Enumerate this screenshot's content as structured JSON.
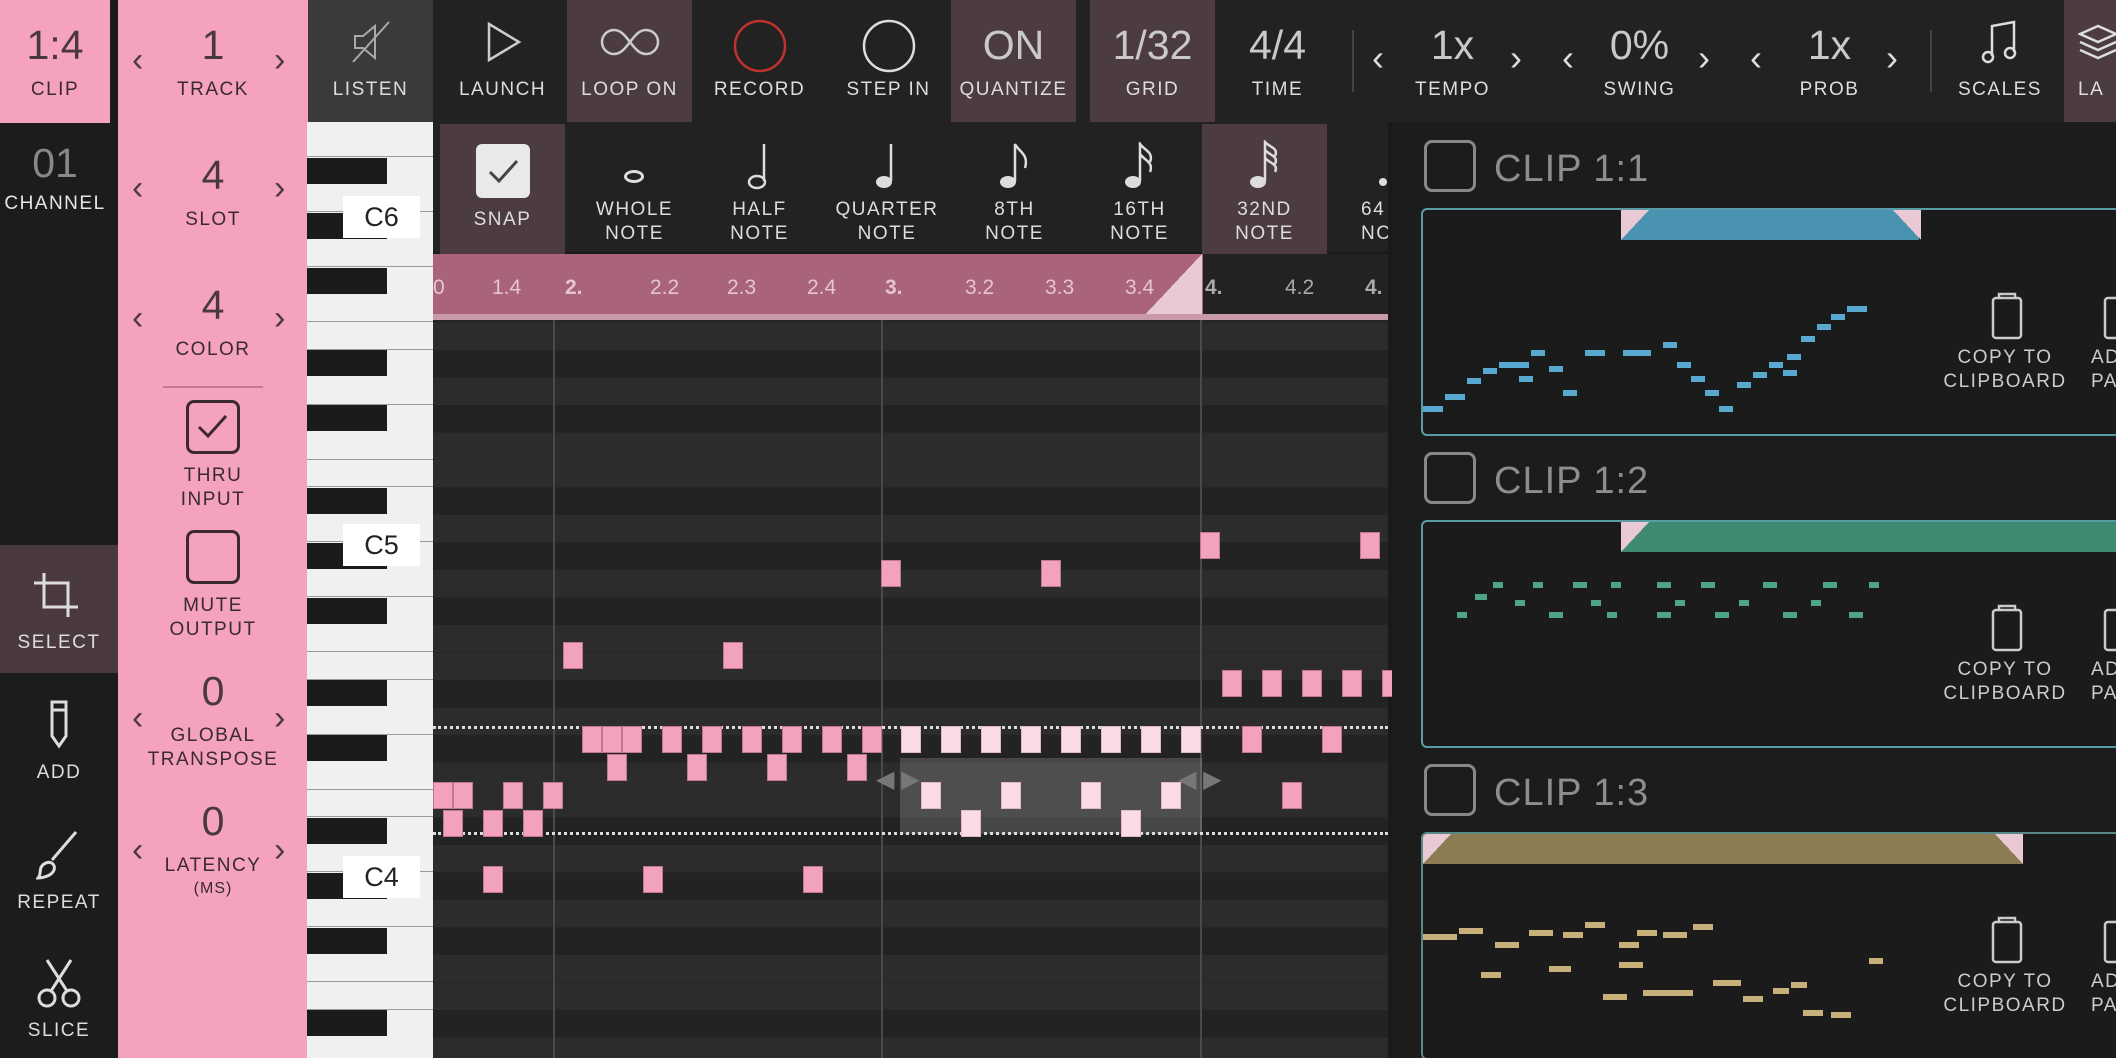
{
  "colors": {
    "accent": "#f4a2bf",
    "clip1": "#58a9cf",
    "clip2": "#4fa386",
    "clip3": "#c7b07a"
  },
  "sidebar": {
    "clip": {
      "value": "1:4",
      "label": "CLIP"
    },
    "channel": {
      "value": "01",
      "label": "CHANNEL"
    },
    "tools": [
      {
        "label": "SELECT",
        "icon": "crop-icon"
      },
      {
        "label": "ADD",
        "icon": "pencil-icon"
      },
      {
        "label": "REPEAT",
        "icon": "brush-icon"
      },
      {
        "label": "SLICE",
        "icon": "scissors-icon"
      }
    ]
  },
  "settings": {
    "track": {
      "value": "1",
      "label": "TRACK"
    },
    "slot": {
      "value": "4",
      "label": "SLOT"
    },
    "color": {
      "value": "4",
      "label": "COLOR"
    },
    "thru": {
      "label1": "THRU",
      "label2": "INPUT"
    },
    "mute": {
      "label1": "MUTE",
      "label2": "OUTPUT"
    },
    "transpose": {
      "value": "0",
      "label1": "GLOBAL",
      "label2": "TRANSPOSE"
    },
    "latency": {
      "value": "0",
      "label": "LATENCY",
      "unit": "(MS)"
    }
  },
  "toolbar": {
    "listen": "LISTEN",
    "launch": "LAUNCH",
    "loop": "LOOP ON",
    "record": "RECORD",
    "stepin": "STEP IN",
    "quantize": {
      "value": "ON",
      "label": "QUANTIZE"
    },
    "grid": {
      "value": "1/32",
      "label": "GRID"
    },
    "time": {
      "value": "4/4",
      "label": "TIME"
    },
    "tempo": {
      "value": "1x",
      "label": "TEMPO"
    },
    "swing": {
      "value": "0%",
      "label": "SWING"
    },
    "prob": {
      "value": "1x",
      "label": "PROB"
    },
    "scales": "SCALES",
    "layers": "LA"
  },
  "notebar": {
    "snap": "SNAP",
    "items": [
      [
        "WHOLE",
        "NOTE"
      ],
      [
        "HALF",
        "NOTE"
      ],
      [
        "QUARTER",
        "NOTE"
      ],
      [
        "8TH",
        "NOTE"
      ],
      [
        "16TH",
        "NOTE"
      ],
      [
        "32ND",
        "NOTE"
      ],
      [
        "64",
        "NC"
      ]
    ]
  },
  "piano": {
    "labels": [
      "C6",
      "C5",
      "C4"
    ]
  },
  "ruler": {
    "ticks": [
      "0",
      "1.4",
      "2.",
      "2.2",
      "2.3",
      "2.4",
      "3.",
      "3.2",
      "3.3",
      "3.4",
      "4.",
      "4.2",
      "4."
    ]
  },
  "clips": [
    {
      "title": "CLIP 1:1",
      "copy1": "COPY TO",
      "copy2": "CLIPBOARD",
      "add1": "AD",
      "add2": "PAT"
    },
    {
      "title": "CLIP 1:2",
      "copy1": "COPY TO",
      "copy2": "CLIPBOARD",
      "add1": "AD",
      "add2": "PAT"
    },
    {
      "title": "CLIP 1:3",
      "copy1": "COPY TO",
      "copy2": "CLIPBOARD",
      "add1": "AD",
      "add2": "PAT"
    }
  ]
}
